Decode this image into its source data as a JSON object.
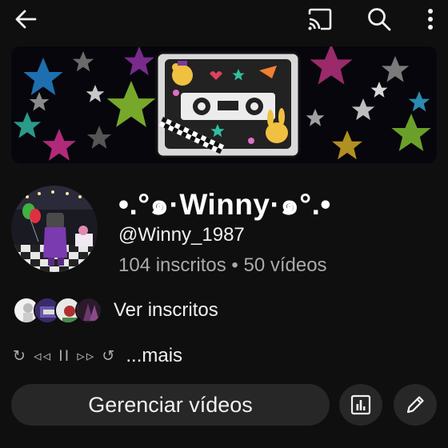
{
  "topbar": {
    "back_icon": "arrow-left-icon",
    "cast_icon": "cast-icon",
    "search_icon": "search-icon",
    "more_icon": "more-vertical-icon"
  },
  "channel": {
    "name": "•.°๑·Winny·๑°.•",
    "handle": "@Winny_1987",
    "stats": "104 inscritos • 50 vídeos"
  },
  "subscribers": {
    "label": "Ver inscritos"
  },
  "description": {
    "symbols": "↻ ◃◃ II ▹▹ ↺",
    "more_label": "...mais"
  },
  "actions": {
    "manage_label": "Gerenciar vídeos",
    "analytics_icon": "analytics-icon",
    "edit_icon": "edit-pencil-icon"
  },
  "colors": {
    "background": "#0f0f0f",
    "button_bg": "#272727",
    "secondary_text": "#aaaaaa"
  }
}
